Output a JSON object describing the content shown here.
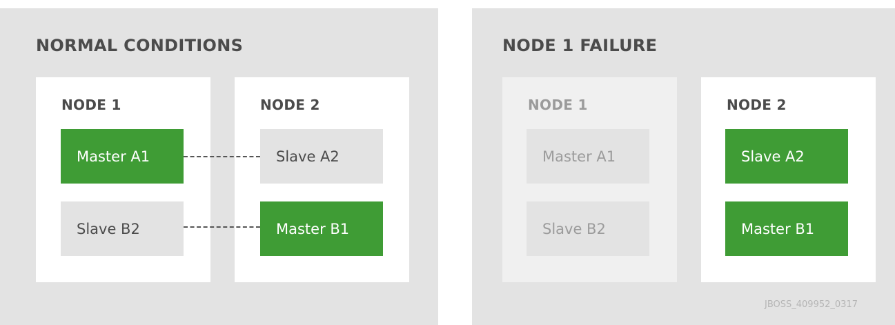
{
  "normal": {
    "title": "NORMAL CONDITIONS",
    "node1": {
      "title": "NODE 1",
      "box_a": "Master A1",
      "box_b": "Slave B2"
    },
    "node2": {
      "title": "NODE 2",
      "box_a": "Slave A2",
      "box_b": "Master B1"
    }
  },
  "failure": {
    "title": "NODE 1 FAILURE",
    "node1": {
      "title": "NODE 1",
      "box_a": "Master A1",
      "box_b": "Slave B2"
    },
    "node2": {
      "title": "NODE 2",
      "box_a": "Slave A2",
      "box_b": "Master B1"
    }
  },
  "footer": {
    "code": "JBOSS_409952_0317"
  },
  "colors": {
    "active": "#3f9c35",
    "panel": "#e3e3e3",
    "text": "#4b4b4b",
    "faded_text": "#9b9b9b"
  }
}
